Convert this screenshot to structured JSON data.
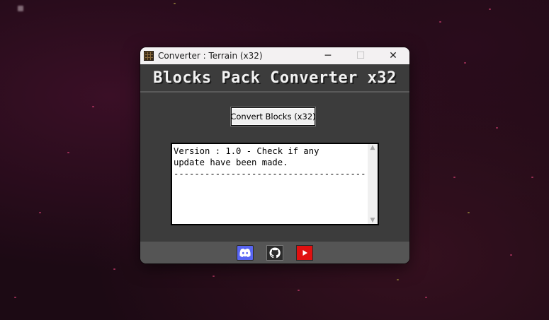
{
  "window": {
    "title": "Converter : Terrain (x32)",
    "minimize_symbol": "─",
    "maximize_symbol": "☐",
    "close_symbol": "✕"
  },
  "banner": {
    "title": "Blocks Pack Converter x32"
  },
  "main": {
    "convert_button_label": "Convert Blocks (x32)",
    "log_text": "Version : 1.0 - Check if any\nupdate have been made.\n-------------------------------------"
  },
  "footer": {
    "links": [
      {
        "name": "discord-icon",
        "color": "#5865f2"
      },
      {
        "name": "github-icon",
        "color": "#2b2b2b"
      },
      {
        "name": "youtube-icon",
        "color": "#e01010"
      }
    ]
  }
}
